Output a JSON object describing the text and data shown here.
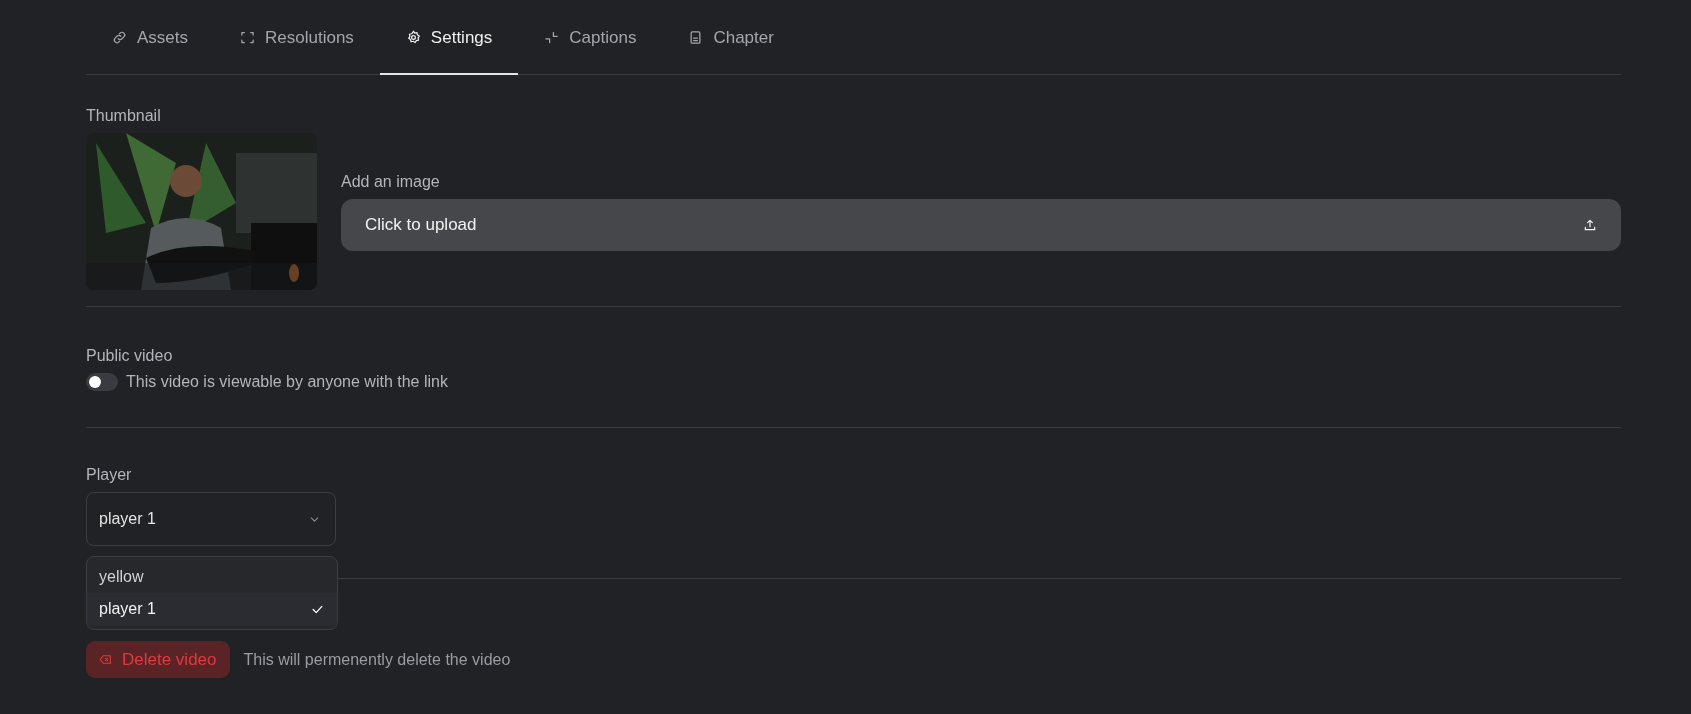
{
  "tabs": [
    {
      "label": "Assets",
      "selected": false
    },
    {
      "label": "Resolutions",
      "selected": false
    },
    {
      "label": "Settings",
      "selected": true
    },
    {
      "label": "Captions",
      "selected": false
    },
    {
      "label": "Chapter",
      "selected": false
    }
  ],
  "thumbnail": {
    "label": "Thumbnail",
    "upload_label": "Add an image",
    "upload_button": "Click to upload"
  },
  "public_video": {
    "label": "Public video",
    "on": false,
    "description": "This video is viewable by anyone with the link"
  },
  "player": {
    "label": "Player",
    "value": "player 1",
    "expanded": true,
    "options": [
      {
        "label": "yellow",
        "selected": false
      },
      {
        "label": "player 1",
        "selected": true
      }
    ]
  },
  "delete": {
    "button": "Delete video",
    "description": "This will permenently delete the video"
  }
}
